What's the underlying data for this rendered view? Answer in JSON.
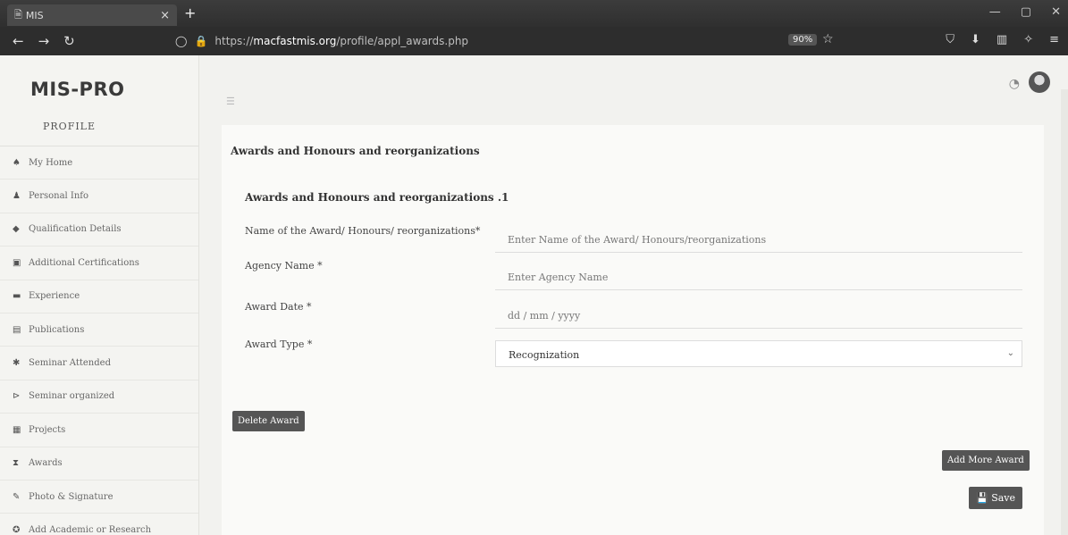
{
  "browser": {
    "tab_title": "MIS",
    "tab_close": "×",
    "new_tab": "+",
    "url_prefix": "https://",
    "url_domain": "macfastmis.org",
    "url_path": "/profile/appl_awards.php",
    "zoom": "90%"
  },
  "app": {
    "brand": "MIS-PRO",
    "profile_title": "PROFILE"
  },
  "sidebar": {
    "items": [
      {
        "label": "My Home",
        "icon": "home-icon"
      },
      {
        "label": "Personal Info",
        "icon": "user-icon"
      },
      {
        "label": "Qualification Details",
        "icon": "graduation-icon"
      },
      {
        "label": "Additional Certifications",
        "icon": "certificate-icon"
      },
      {
        "label": "Experience",
        "icon": "briefcase-icon"
      },
      {
        "label": "Publications",
        "icon": "document-icon"
      },
      {
        "label": "Seminar Attended",
        "icon": "seminar-icon"
      },
      {
        "label": "Seminar organized",
        "icon": "organized-icon"
      },
      {
        "label": "Projects",
        "icon": "projects-icon"
      },
      {
        "label": "Awards",
        "icon": "award-icon"
      },
      {
        "label": "Photo & Signature",
        "icon": "photo-icon"
      },
      {
        "label": "Add Academic or Research",
        "icon": "research-icon"
      }
    ]
  },
  "form": {
    "title": "Awards and Honours and reorganizations",
    "subheading": "Awards and Honours and reorganizations .1",
    "name_label": "Name of the Award/ Honours/ reorganizations*",
    "name_placeholder": "Enter Name of the Award/ Honours/reorganizations",
    "agency_label": "Agency Name *",
    "agency_placeholder": "Enter Agency Name",
    "date_label": "Award Date *",
    "date_placeholder": "dd / mm / yyyy",
    "type_label": "Award Type *",
    "type_value": "Recognization",
    "delete_button": "Delete Award",
    "add_more_button": "Add More Award",
    "save_button": "Save"
  }
}
